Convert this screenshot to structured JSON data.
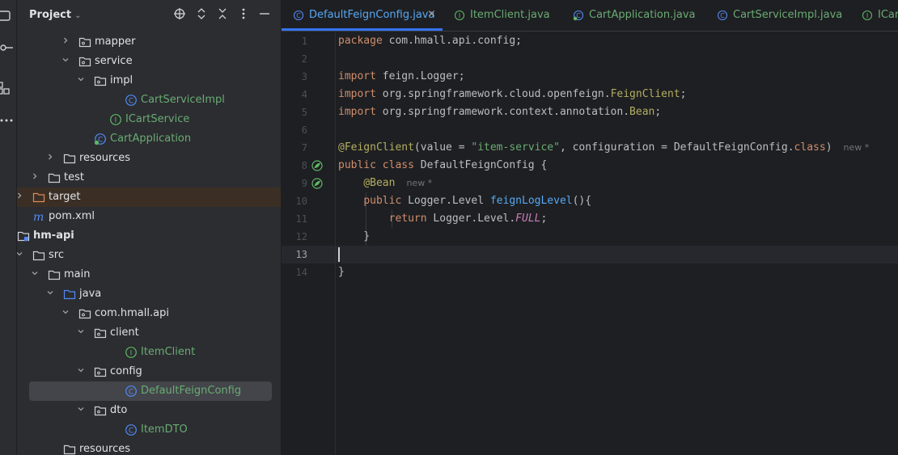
{
  "project": {
    "title": "Project",
    "tree": [
      {
        "label": "mapper",
        "type": "package",
        "arrow": "closed",
        "level": 6
      },
      {
        "label": "service",
        "type": "package",
        "arrow": "open",
        "level": 6
      },
      {
        "label": "impl",
        "type": "package",
        "arrow": "open",
        "level": 7
      },
      {
        "label": "CartServiceImpl",
        "type": "class",
        "level": 9
      },
      {
        "label": "ICartService",
        "type": "interface",
        "level": 8
      },
      {
        "label": "CartApplication",
        "type": "app",
        "level": 7
      },
      {
        "label": "resources",
        "type": "folder",
        "arrow": "closed",
        "level": 5
      },
      {
        "label": "test",
        "type": "folder",
        "arrow": "closed",
        "level": 4
      },
      {
        "label": "target",
        "type": "folder-orange",
        "arrow": "closed",
        "level": 3
      },
      {
        "label": "pom.xml",
        "type": "maven",
        "level": 3
      },
      {
        "label": "hm-api",
        "type": "module",
        "arrow": "open",
        "level": 2
      },
      {
        "label": "src",
        "type": "folder",
        "arrow": "open",
        "level": 3
      },
      {
        "label": "main",
        "type": "folder",
        "arrow": "open",
        "level": 4
      },
      {
        "label": "java",
        "type": "folder-blue",
        "arrow": "open",
        "level": 5
      },
      {
        "label": "com.hmall.api",
        "type": "package",
        "arrow": "open",
        "level": 6
      },
      {
        "label": "client",
        "type": "package",
        "arrow": "open",
        "level": 7
      },
      {
        "label": "ItemClient",
        "type": "interface",
        "level": 9
      },
      {
        "label": "config",
        "type": "package",
        "arrow": "open",
        "level": 7
      },
      {
        "label": "DefaultFeignConfig",
        "type": "class",
        "level": 9
      },
      {
        "label": "dto",
        "type": "package",
        "arrow": "open",
        "level": 7
      },
      {
        "label": "ItemDTO",
        "type": "class",
        "level": 9
      },
      {
        "label": "resources",
        "type": "folder",
        "level": 5
      }
    ]
  },
  "tabs": [
    {
      "label": "DefaultFeignConfig.java",
      "icon": "class-icon",
      "active": true,
      "close": "×"
    },
    {
      "label": "ItemClient.java",
      "icon": "interface-icon"
    },
    {
      "label": "CartApplication.java",
      "icon": "app-class-icon"
    },
    {
      "label": "CartServiceImpl.java",
      "icon": "class-icon"
    },
    {
      "label": "ICar",
      "icon": "interface-icon"
    }
  ],
  "editor": {
    "line_numbers": [
      "1",
      "2",
      "3",
      "4",
      "5",
      "6",
      "7",
      "8",
      "9",
      "10",
      "11",
      "12",
      "13",
      "14"
    ],
    "current_line": "13",
    "lines": [
      [
        {
          "t": "package ",
          "c": "kw"
        },
        {
          "t": "com.hmall.api.config;",
          "c": ""
        }
      ],
      [],
      [
        {
          "t": "import ",
          "c": "kw"
        },
        {
          "t": "feign.Logger;",
          "c": ""
        }
      ],
      [
        {
          "t": "import ",
          "c": "kw"
        },
        {
          "t": "org.springframework.cloud.openfeign.",
          "c": ""
        },
        {
          "t": "FeignClient",
          "c": "ann"
        },
        {
          "t": ";",
          "c": ""
        }
      ],
      [
        {
          "t": "import ",
          "c": "kw"
        },
        {
          "t": "org.springframework.context.annotation.",
          "c": ""
        },
        {
          "t": "Bean",
          "c": "ann"
        },
        {
          "t": ";",
          "c": ""
        }
      ],
      [],
      [
        {
          "t": "@FeignClient",
          "c": "ann"
        },
        {
          "t": "(value = ",
          "c": ""
        },
        {
          "t": "\"item-service\"",
          "c": "str"
        },
        {
          "t": ", configuration = DefaultFeignConfig.",
          "c": ""
        },
        {
          "t": "class",
          "c": "kw"
        },
        {
          "t": ")",
          "c": ""
        },
        {
          "t": "new *",
          "c": "hint"
        }
      ],
      [
        {
          "t": "public class ",
          "c": "kw"
        },
        {
          "t": "DefaultFeignConfig {",
          "c": ""
        }
      ],
      [
        {
          "t": "    ",
          "c": ""
        },
        {
          "t": "@Bean",
          "c": "ann"
        },
        {
          "t": "new *",
          "c": "hint"
        }
      ],
      [
        {
          "t": "    ",
          "c": ""
        },
        {
          "t": "public ",
          "c": "kw"
        },
        {
          "t": "Logger.Level ",
          "c": ""
        },
        {
          "t": "feignLogLevel",
          "c": "fn"
        },
        {
          "t": "(){",
          "c": ""
        }
      ],
      [
        {
          "t": "        ",
          "c": ""
        },
        {
          "t": "return ",
          "c": "kw"
        },
        {
          "t": "Logger.Level.",
          "c": ""
        },
        {
          "t": "FULL",
          "c": "const"
        },
        {
          "t": ";",
          "c": ""
        }
      ],
      [
        {
          "t": "    }",
          "c": ""
        }
      ],
      [],
      [
        {
          "t": "}",
          "c": ""
        }
      ]
    ]
  },
  "colors": {
    "accent": "#3574f0",
    "selection": "#43454a",
    "class_icon": "#548af7",
    "interface_icon": "#5fb865",
    "spring_icon": "#5fb865"
  }
}
